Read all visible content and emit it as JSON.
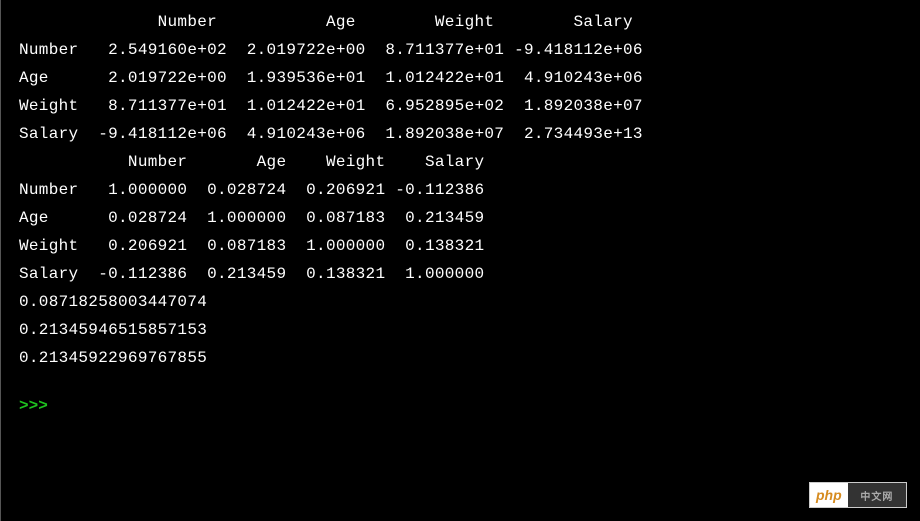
{
  "table1": {
    "header": "              Number           Age        Weight        Salary",
    "rows": [
      "Number   2.549160e+02  2.019722e+00  8.711377e+01 -9.418112e+06",
      "Age      2.019722e+00  1.939536e+01  1.012422e+01  4.910243e+06",
      "Weight   8.711377e+01  1.012422e+01  6.952895e+02  1.892038e+07",
      "Salary  -9.418112e+06  4.910243e+06  1.892038e+07  2.734493e+13"
    ]
  },
  "table2": {
    "header": "           Number       Age    Weight    Salary",
    "rows": [
      "Number   1.000000  0.028724  0.206921 -0.112386",
      "Age      0.028724  1.000000  0.087183  0.213459",
      "Weight   0.206921  0.087183  1.000000  0.138321",
      "Salary  -0.112386  0.213459  0.138321  1.000000"
    ]
  },
  "scalars": [
    "0.08718258003447074",
    "0.21345946515857153",
    "0.21345922969767855"
  ],
  "prompt": ">>> ",
  "watermark": {
    "left": "php",
    "right": "中文网"
  }
}
